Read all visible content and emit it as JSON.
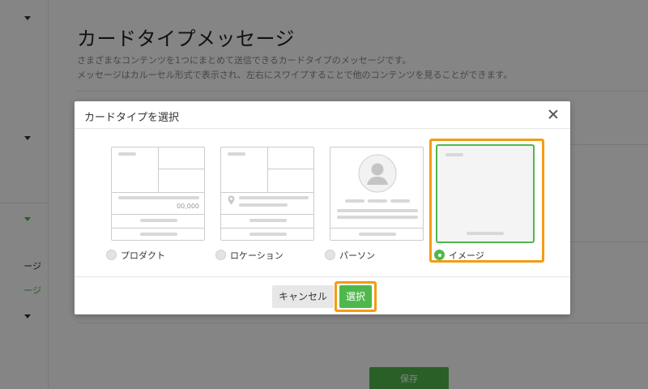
{
  "page": {
    "title": "カードタイプメッセージ",
    "description_line1": "さまざまなコンテンツを1つにまとめて送信できるカードタイプのメッセージです。",
    "description_line2": "メッセージはカルーセル形式で表示され、左右にスワイプすることで他のコンテンツを見ることができます。",
    "save_label": "保存"
  },
  "sidebar": {
    "item_1_partial": "ージ",
    "item_2_partial": "ージ"
  },
  "modal": {
    "title": "カードタイプを選択",
    "cancel_label": "キャンセル",
    "select_label": "選択",
    "card_types": [
      {
        "label": "プロダクト",
        "selected": false
      },
      {
        "label": "ロケーション",
        "selected": false
      },
      {
        "label": "パーソン",
        "selected": false
      },
      {
        "label": "イメージ",
        "selected": true
      }
    ],
    "product_price": "00,000"
  },
  "colors": {
    "accent_green": "#4fb84c",
    "highlight_orange": "#f39c12"
  },
  "icons": [
    "close-icon",
    "location-pin-icon",
    "person-avatar-icon",
    "chevron-down-icon"
  ]
}
